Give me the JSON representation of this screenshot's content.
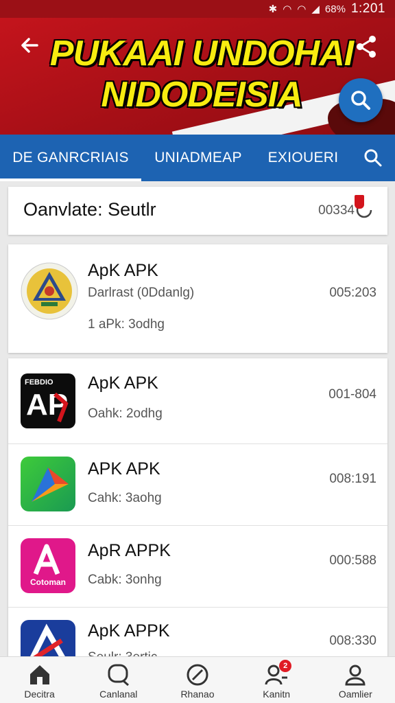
{
  "status_bar": {
    "battery": "68%",
    "time": "1:201"
  },
  "header": {
    "title_line1": "PUKAAI UNDOHAI",
    "title_line2": "NIDODEISIA"
  },
  "tabs": [
    {
      "label": "DE GANRCRIAIS",
      "active": true
    },
    {
      "label": "UNIADMEAP",
      "active": false
    },
    {
      "label": "EXIOUERI",
      "active": false
    }
  ],
  "search_row": {
    "query": "Oanvlate: Seutlr",
    "count": "00334"
  },
  "items": [
    {
      "name": "ApK APK",
      "sub": "Darlrast (0Ddanlg)",
      "meta": "1 aPk: 3odhg",
      "size": "005:203"
    },
    {
      "name": "ApK APK",
      "sub": "Oahk: 2odhg",
      "size": "001-804",
      "icon_text": "AP",
      "icon_top": "FEBDIO"
    },
    {
      "name": "APK APK",
      "sub": "Cahk: 3aohg",
      "size": "008:191"
    },
    {
      "name": "ApR APPK",
      "sub": "Cabk: 3onhg",
      "size": "000:588",
      "icon_text": "Cotoman"
    },
    {
      "name": "ApK APPK",
      "sub": "Seulr: 3ertic",
      "size": "008:330"
    }
  ],
  "bottom_nav": [
    {
      "label": "Decitra",
      "icon": "home-icon"
    },
    {
      "label": "Canlanal",
      "icon": "chat-icon"
    },
    {
      "label": "Rhanao",
      "icon": "block-icon"
    },
    {
      "label": "Kanitn",
      "icon": "users-icon",
      "badge": "2"
    },
    {
      "label": "Oamlier",
      "icon": "profile-icon"
    }
  ],
  "colors": {
    "header_red": "#c4141c",
    "title_yellow": "#f7ec10",
    "tab_blue": "#1d63b2",
    "fab_blue": "#1f6fbf"
  }
}
